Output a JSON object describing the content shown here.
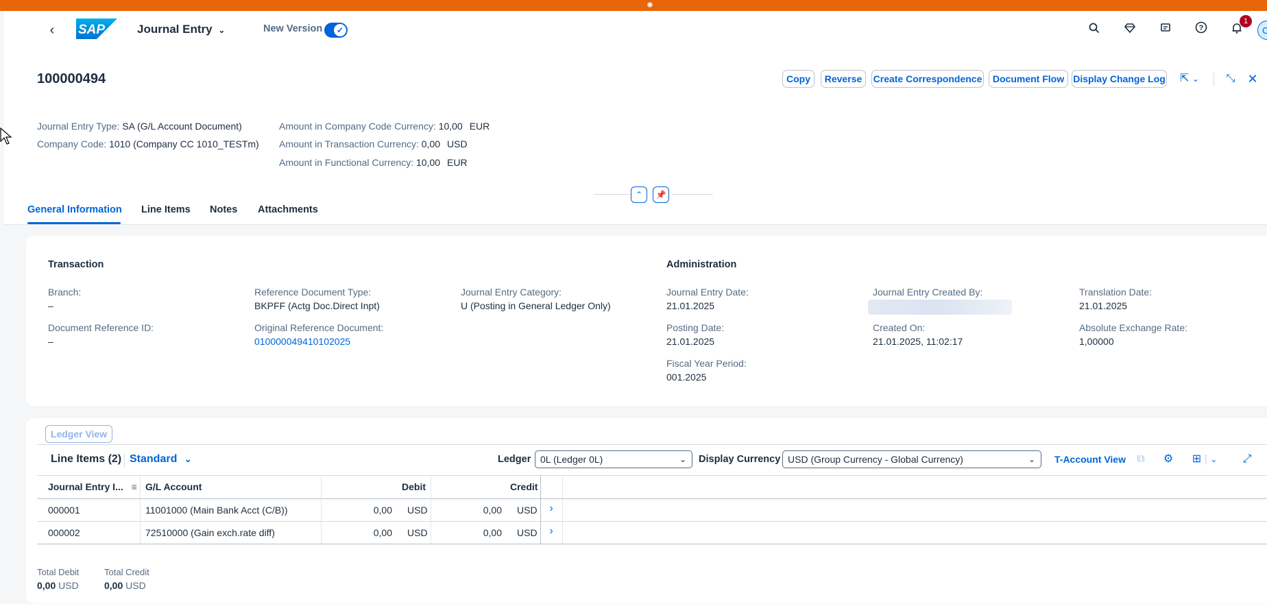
{
  "shell": {
    "app_title": "Journal Entry",
    "new_version_label": "New Version",
    "notification_count": "1",
    "avatar_initial": "C",
    "logo_text": "SAP"
  },
  "header": {
    "title": "100000494",
    "actions": [
      "Copy",
      "Reverse",
      "Create Correspondence",
      "Document Flow",
      "Display Change Log"
    ],
    "journal_entry_type_label": "Journal Entry Type:",
    "journal_entry_type_value": "SA (G/L Account Document)",
    "company_code_label": "Company Code:",
    "company_code_value": "1010 (Company CC 1010_TESTm)",
    "amt_cc_label": "Amount in Company Code Currency:",
    "amt_cc_value": "10,00",
    "amt_cc_unit": "EUR",
    "amt_tc_label": "Amount in Transaction Currency:",
    "amt_tc_value": "0,00",
    "amt_tc_unit": "USD",
    "amt_fc_label": "Amount in Functional Currency:",
    "amt_fc_value": "10,00",
    "amt_fc_unit": "EUR"
  },
  "tabs": [
    "General Information",
    "Line Items",
    "Notes",
    "Attachments"
  ],
  "general": {
    "transaction_title": "Transaction",
    "admin_title": "Administration",
    "branch_label": "Branch:",
    "branch_value": "–",
    "docref_label": "Document Reference ID:",
    "docref_value": "–",
    "refdoctype_label": "Reference Document Type:",
    "refdoctype_value": "BKPFF (Actg Doc.Direct Inpt)",
    "origref_label": "Original Reference Document:",
    "origref_value": "010000049410102025",
    "jecat_label": "Journal Entry Category:",
    "jecat_value": "U (Posting in General Ledger Only)",
    "jedate_label": "Journal Entry Date:",
    "jedate_value": "21.01.2025",
    "postdate_label": "Posting Date:",
    "postdate_value": "21.01.2025",
    "fyp_label": "Fiscal Year Period:",
    "fyp_value": "001.2025",
    "createdby_label": "Journal Entry Created By:",
    "createdon_label": "Created On:",
    "createdon_value": "21.01.2025, 11:02:17",
    "transdate_label": "Translation Date:",
    "transdate_value": "21.01.2025",
    "absrate_label": "Absolute Exchange Rate:",
    "absrate_value": "1,00000"
  },
  "line_items": {
    "ledger_view_label": "Ledger View",
    "title": "Line Items (2)",
    "variant": "Standard",
    "ledger_label": "Ledger",
    "ledger_value": "0L (Ledger 0L)",
    "currency_label": "Display Currency",
    "currency_value": "USD (Group Currency - Global Currency)",
    "taccount_label": "T-Account View",
    "columns": [
      "Journal Entry I...",
      "G/L Account",
      "Debit",
      "Credit"
    ],
    "rows": [
      {
        "item": "000001",
        "account": "11001000 (Main Bank Acct (C/B))",
        "debit": "0,00",
        "debit_cur": "USD",
        "credit": "0,00",
        "credit_cur": "USD"
      },
      {
        "item": "000002",
        "account": "72510000 (Gain exch.rate diff)",
        "debit": "0,00",
        "debit_cur": "USD",
        "credit": "0,00",
        "credit_cur": "USD"
      }
    ],
    "total_debit_label": "Total Debit",
    "total_debit_value": "0,00",
    "total_debit_unit": "USD",
    "total_credit_label": "Total Credit",
    "total_credit_value": "0,00",
    "total_credit_unit": "USD"
  },
  "colors": {
    "top_strip": "#e8650a",
    "accent": "#0064d9",
    "text": "#1d2d3e",
    "label": "#556b82",
    "badge": "#b00020"
  }
}
